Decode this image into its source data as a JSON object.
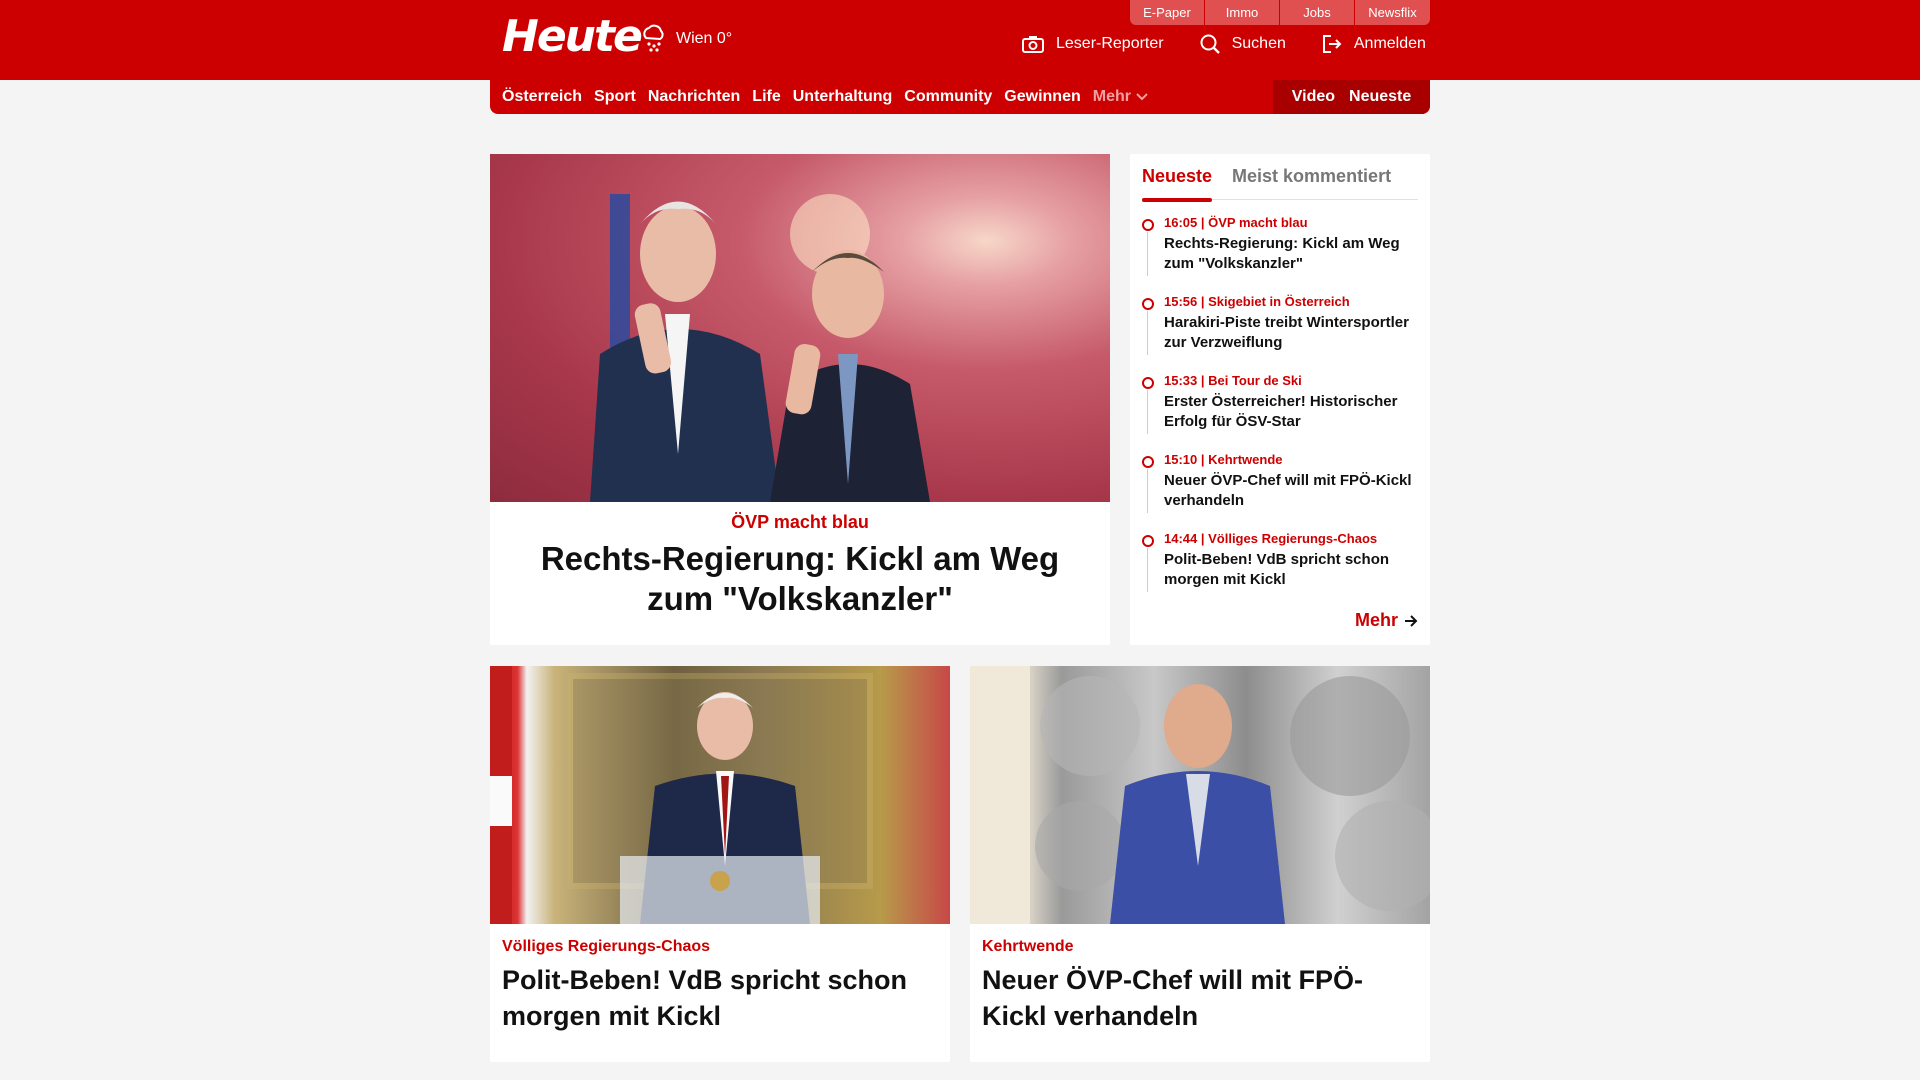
{
  "header": {
    "logo": "Heute",
    "weather": "Wien 0°",
    "top_links": [
      "E-Paper",
      "Immo",
      "Jobs",
      "Newsflix"
    ],
    "actions": {
      "reporter": "Leser-Reporter",
      "search": "Suchen",
      "login": "Anmelden"
    }
  },
  "nav": {
    "items": [
      "Österreich",
      "Sport",
      "Nachrichten",
      "Life",
      "Unterhaltung",
      "Community",
      "Gewinnen"
    ],
    "more": "Mehr",
    "right": [
      "Video",
      "Neueste"
    ]
  },
  "hero": {
    "kicker": "ÖVP macht blau",
    "title": "Rechts-Regierung: Kickl am Weg zum \"Volkskanzler\""
  },
  "sidebar": {
    "tabs": [
      "Neueste",
      "Meist kommentiert"
    ],
    "items": [
      {
        "meta": "16:05 | ÖVP macht blau",
        "title": "Rechts-Regierung: Kickl am Weg zum \"Volkskanzler\""
      },
      {
        "meta": "15:56 | Skigebiet in Österreich",
        "title": "Harakiri-Piste treibt Wintersportler zur Verzweiflung"
      },
      {
        "meta": "15:33 | Bei Tour de Ski",
        "title": "Erster Österreicher! Historischer Erfolg für ÖSV-Star"
      },
      {
        "meta": "15:10 | Kehrtwende",
        "title": "Neuer ÖVP-Chef will mit FPÖ-Kickl verhandeln"
      },
      {
        "meta": "14:44 | Völliges Regierungs-Chaos",
        "title": "Polit-Beben! VdB spricht schon morgen mit Kickl"
      }
    ],
    "more": "Mehr"
  },
  "cards": [
    {
      "kicker": "Völliges Regierungs-Chaos",
      "title": "Polit-Beben! VdB spricht schon morgen mit Kickl"
    },
    {
      "kicker": "Kehrtwende",
      "title": "Neuer ÖVP-Chef will mit FPÖ-Kickl verhandeln"
    }
  ],
  "colors": {
    "brand": "#cc0000",
    "brand_dark": "#a80000"
  }
}
